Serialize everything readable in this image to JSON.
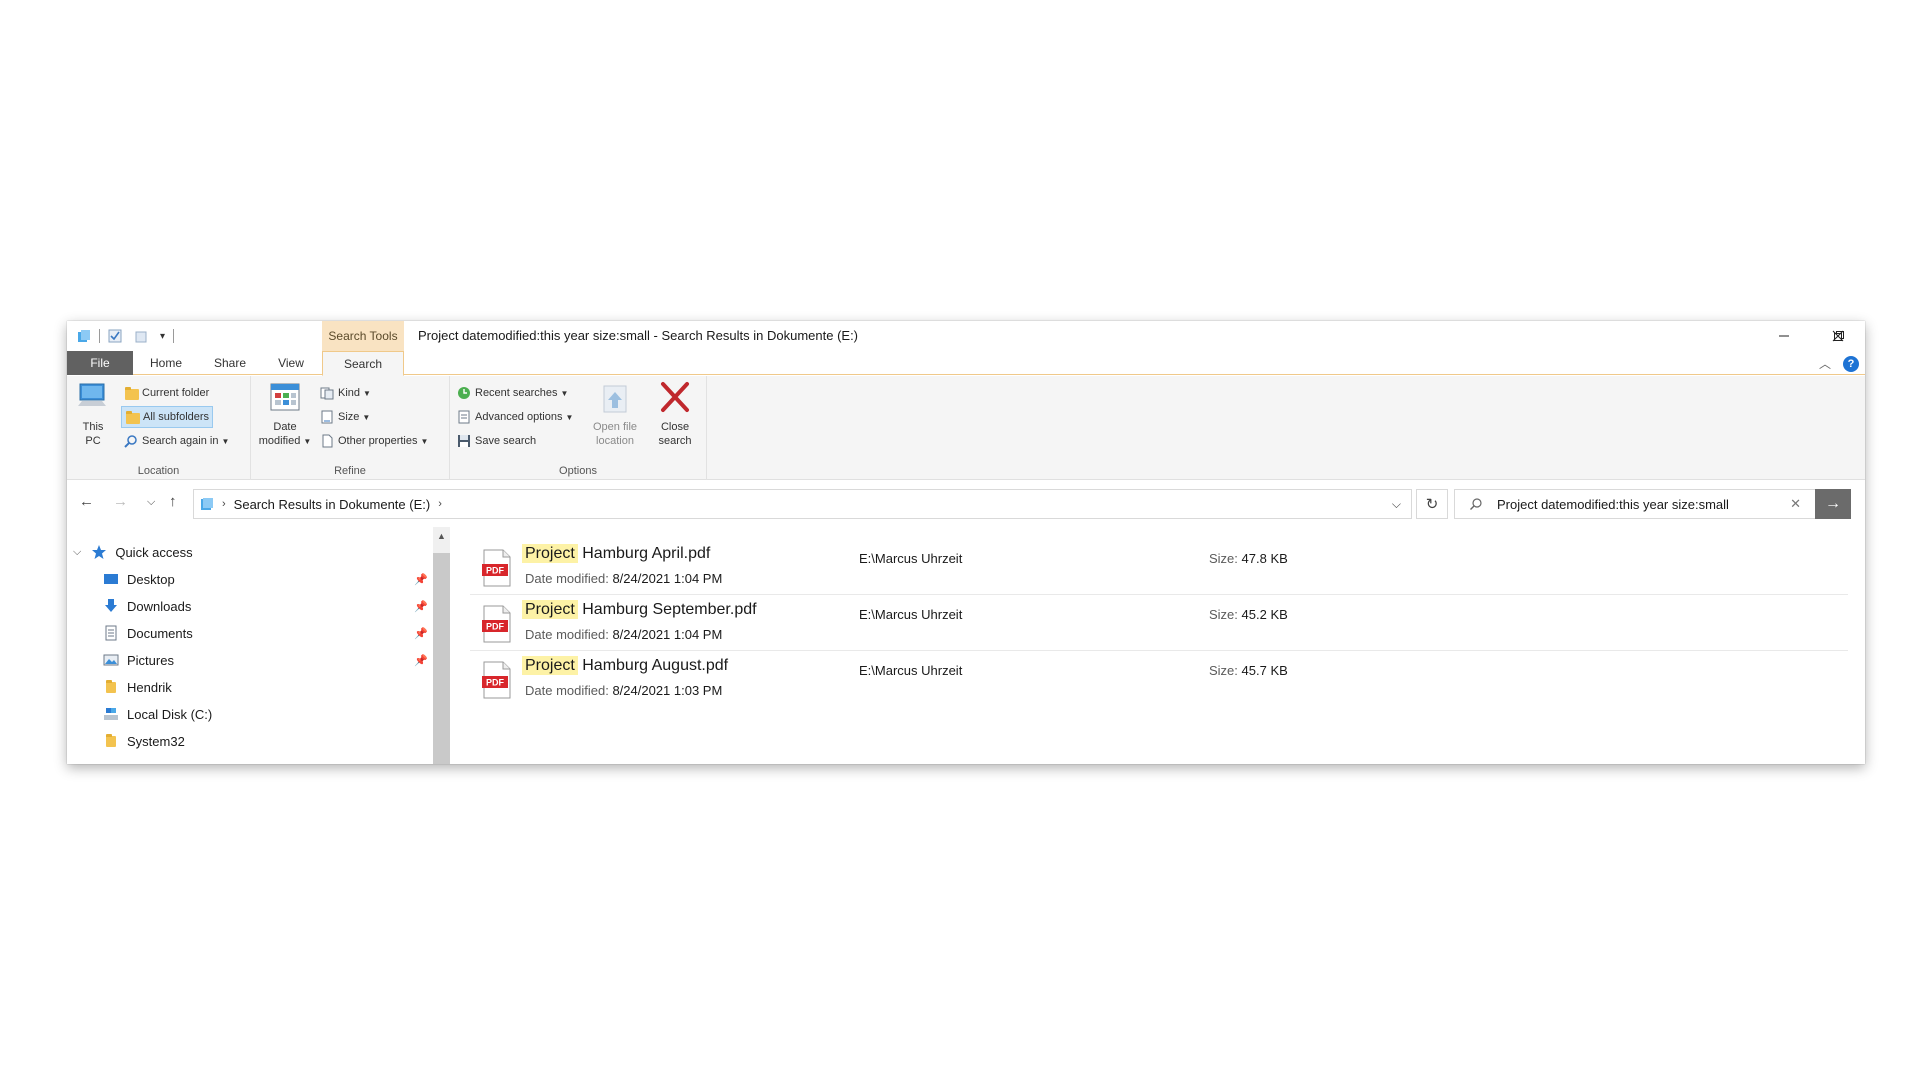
{
  "window": {
    "title": "Project datemodified:this year size:small - Search Results in Dokumente (E:)",
    "context_tab_header": "Search Tools"
  },
  "ribbon_tabs": [
    "File",
    "Home",
    "Share",
    "View",
    "Search"
  ],
  "ribbon": {
    "location": {
      "label": "Location",
      "this_pc_line1": "This",
      "this_pc_line2": "PC",
      "current_folder": "Current folder",
      "all_subfolders": "All subfolders",
      "search_again_in": "Search again in"
    },
    "refine": {
      "label": "Refine",
      "date_modified_line1": "Date",
      "date_modified_line2": "modified",
      "kind": "Kind",
      "size": "Size",
      "other_properties": "Other properties"
    },
    "options": {
      "label": "Options",
      "recent_searches": "Recent searches",
      "advanced_options": "Advanced options",
      "save_search": "Save search",
      "open_file_location_line1": "Open file",
      "open_file_location_line2": "location",
      "close_search_line1": "Close",
      "close_search_line2": "search"
    }
  },
  "address": {
    "path": "Search Results in Dokumente (E:)"
  },
  "search": {
    "query": "Project datemodified:this year size:small"
  },
  "navpane": {
    "quick_access": "Quick access",
    "items": [
      {
        "label": "Desktop",
        "pinned": true
      },
      {
        "label": "Downloads",
        "pinned": true
      },
      {
        "label": "Documents",
        "pinned": true
      },
      {
        "label": "Pictures",
        "pinned": true
      },
      {
        "label": "Hendrik",
        "pinned": false
      },
      {
        "label": "Local Disk (C:)",
        "pinned": false
      },
      {
        "label": "System32",
        "pinned": false
      }
    ]
  },
  "results": {
    "date_label": "Date modified:",
    "size_label": "Size:",
    "items": [
      {
        "highlight": "Project",
        "rest": " Hamburg April.pdf",
        "date": "8/24/2021 1:04 PM",
        "location": "E:\\Marcus Uhrzeit",
        "size": "47.8 KB"
      },
      {
        "highlight": "Project",
        "rest": " Hamburg September.pdf",
        "date": "8/24/2021 1:04 PM",
        "location": "E:\\Marcus Uhrzeit",
        "size": "45.2 KB"
      },
      {
        "highlight": "Project",
        "rest": " Hamburg August.pdf",
        "date": "8/24/2021 1:03 PM",
        "location": "E:\\Marcus Uhrzeit",
        "size": "45.7 KB"
      }
    ],
    "icon_text": "PDF"
  },
  "colors": {
    "accent": "#f0c98a",
    "highlight": "#fdf2a6",
    "close_search": "#c0282d",
    "pdf_red": "#d8262b"
  }
}
